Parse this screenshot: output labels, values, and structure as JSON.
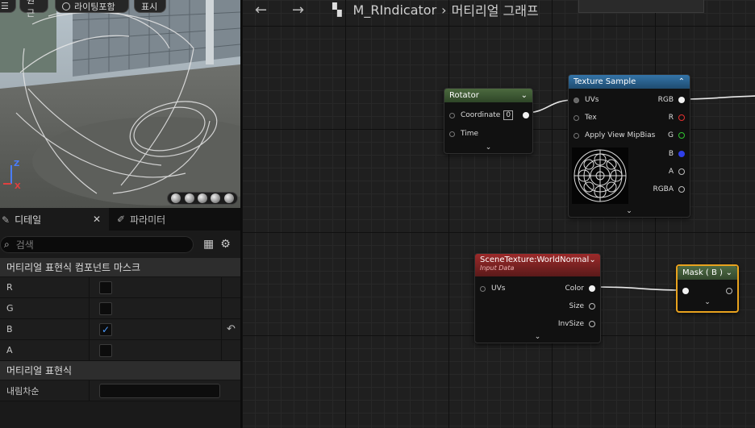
{
  "viewport": {
    "buttons": [
      "원근",
      "라이팅포함",
      "표시"
    ],
    "axis": {
      "z": "Z",
      "x": "X"
    }
  },
  "details": {
    "tab_details": "디테일",
    "tab_params": "파라미터",
    "search_placeholder": "검색",
    "section_mask": "머티리얼 표현식 컴포넌트 마스크",
    "props": [
      {
        "name": "R",
        "checked": false
      },
      {
        "name": "G",
        "checked": false
      },
      {
        "name": "B",
        "checked": true
      },
      {
        "name": "A",
        "checked": false
      }
    ],
    "section_expr": "머티리얼 표현식",
    "desc_label": "내림차순"
  },
  "graph": {
    "asset_name": "M_RIndicator",
    "graph_name": "머티리얼 그래프",
    "nodes": {
      "rotator": {
        "title": "Rotator",
        "coord_label": "Coordinate",
        "coord_value": "0",
        "time_label": "Time",
        "color": "#4c6a3f"
      },
      "texture": {
        "title": "Texture Sample",
        "uvs": "UVs",
        "tex": "Tex",
        "mip": "Apply View MipBias",
        "rgb": "RGB",
        "r": "R",
        "g": "G",
        "b": "B",
        "a": "A",
        "rgba": "RGBA",
        "color": "#3474a8"
      },
      "scene": {
        "title": "SceneTexture:WorldNormal",
        "subtitle": "Input Data",
        "uvs": "UVs",
        "color_label": "Color",
        "size": "Size",
        "invsize": "InvSize",
        "color": "#9c2a2a"
      },
      "mask": {
        "title": "Mask ( B )",
        "color": "#4e6b44",
        "border": "#e8a21e"
      }
    },
    "pin_colors": {
      "r": "#e53030",
      "g": "#2fc52f",
      "b": "#2f3fe8"
    }
  }
}
